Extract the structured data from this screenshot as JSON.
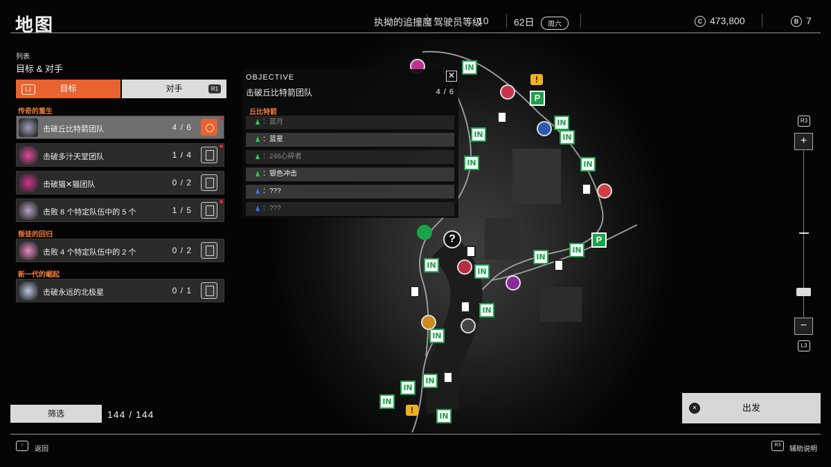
{
  "header": {
    "title": "地图",
    "driver_name": "执拗的追撞魔",
    "driver_level_label": "驾驶员等级",
    "driver_level": "10",
    "day": "62日",
    "weekday": "周六",
    "credits_icon": "C",
    "credits": "473,800",
    "b_icon": "B",
    "b_count": "7"
  },
  "list": {
    "label": "列表",
    "subtitle": "目标 & 对手",
    "tabs": [
      {
        "label": "目标",
        "key": "L1",
        "active": true
      },
      {
        "label": "对手",
        "key": "R1",
        "active": false
      }
    ],
    "sections": [
      {
        "title": "传奇的重生",
        "items": [
          {
            "label": "击破丘比特箭团队",
            "count": "4 / 6",
            "selected": true,
            "new": true,
            "emblem_color": "#9aa0b8"
          },
          {
            "label": "击破多汁天堂团队",
            "count": "1 / 4",
            "selected": false,
            "new": true,
            "emblem_color": "#e24a9a"
          },
          {
            "label": "击破猫✕猫团队",
            "count": "0 / 2",
            "selected": false,
            "new": false,
            "emblem_color": "#d1348e"
          },
          {
            "label": "击败 8 个特定队伍中的 5 个",
            "count": "1 / 5",
            "selected": false,
            "new": true,
            "emblem_color": "#b8a0c8"
          }
        ]
      },
      {
        "title": "叛徒的回归",
        "items": [
          {
            "label": "击败 4 个特定队伍中的 2 个",
            "count": "0 / 2",
            "selected": false,
            "new": false,
            "emblem_color": "#e88ac0"
          }
        ]
      },
      {
        "title": "新一代的崛起",
        "items": [
          {
            "label": "击破永远的北极星",
            "count": "0 / 1",
            "selected": false,
            "new": false,
            "emblem_color": "#b8c4e0"
          }
        ]
      }
    ]
  },
  "filter": {
    "label": "筛选",
    "count": "144 / 144"
  },
  "objective": {
    "header": "OBJECTIVE",
    "title": "击破丘比特箭团队",
    "progress": "4 / 6",
    "close_icon": "close-icon",
    "team": "丘比特箭",
    "members": [
      {
        "name": "：蓝月",
        "status": "defeated",
        "color": "green"
      },
      {
        "name": "：蓝星",
        "status": "active",
        "color": "green"
      },
      {
        "name": "：246心碎者",
        "status": "defeated",
        "color": "green"
      },
      {
        "name": "：银色冲击",
        "status": "active",
        "color": "green"
      },
      {
        "name": "：???",
        "status": "active",
        "color": "blue"
      },
      {
        "name": "：???",
        "status": "defeated",
        "color": "blue"
      }
    ]
  },
  "map": {
    "in_label": "IN",
    "p_label": "P",
    "question_label": "?",
    "alert_label": "!"
  },
  "zoom": {
    "top_key": "R3",
    "plus": "+",
    "minus": "−",
    "bottom_key": "L3",
    "level": 0.15
  },
  "depart": {
    "label": "出发",
    "key": "✕"
  },
  "footer": {
    "back_label": "返回",
    "back_key": "○",
    "help_label": "辅助说明",
    "help_key": "R3"
  },
  "colors": {
    "accent": "#e8632f",
    "section_title": "#f07c3c",
    "in_green": "#1aa34a"
  }
}
